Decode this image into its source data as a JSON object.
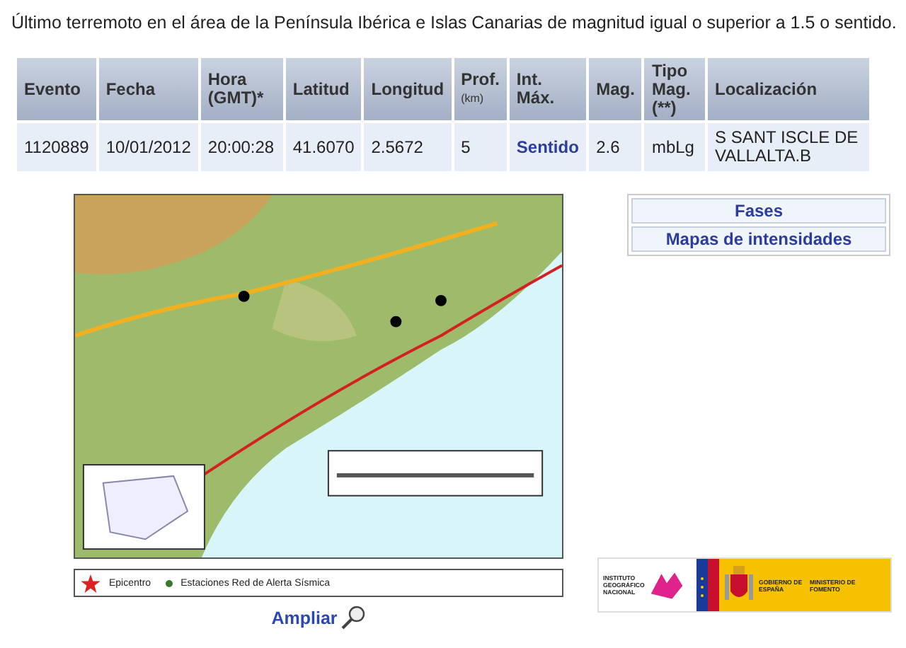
{
  "heading": "Último terremoto en el área de la Península Ibérica e Islas Canarias de magnitud igual o superior a 1.5 o sentido.",
  "table": {
    "columns": [
      {
        "label": "Evento"
      },
      {
        "label": "Fecha"
      },
      {
        "label": "Hora (GMT)*"
      },
      {
        "label": "Latitud"
      },
      {
        "label": "Longitud"
      },
      {
        "label": "Prof.",
        "unit": "(km)"
      },
      {
        "label": "Int. Máx."
      },
      {
        "label": "Mag."
      },
      {
        "label": "Tipo Mag. (**)"
      },
      {
        "label": "Localización"
      }
    ],
    "rows": [
      {
        "cells": [
          {
            "text": "1120889",
            "kind": "text"
          },
          {
            "text": "10/01/2012",
            "kind": "text"
          },
          {
            "text": "20:00:28",
            "kind": "text"
          },
          {
            "text": "41.6070",
            "kind": "text"
          },
          {
            "text": "2.5672",
            "kind": "text"
          },
          {
            "text": "5",
            "kind": "text"
          },
          {
            "text": "Sentido",
            "kind": "link"
          },
          {
            "text": "2.6",
            "kind": "text"
          },
          {
            "text": "mbLg",
            "kind": "text"
          },
          {
            "text": "S SANT ISCLE DE VALLALTA.B",
            "kind": "text"
          }
        ]
      }
    ]
  },
  "legend": [
    {
      "label": "Epicentro",
      "kind": "star"
    },
    {
      "label": "Estaciones Red de Alerta Sísmica",
      "kind": "dot"
    }
  ],
  "enlarge_link": "Ampliar",
  "links": [
    "Fases",
    "Mapas de intensidades"
  ],
  "logos": {
    "ign": "INSTITUTO GEOGRÁFICO NACIONAL",
    "gobierno": "GOBIERNO DE ESPAÑA",
    "ministerio": "MINISTERIO DE FOMENTO"
  }
}
